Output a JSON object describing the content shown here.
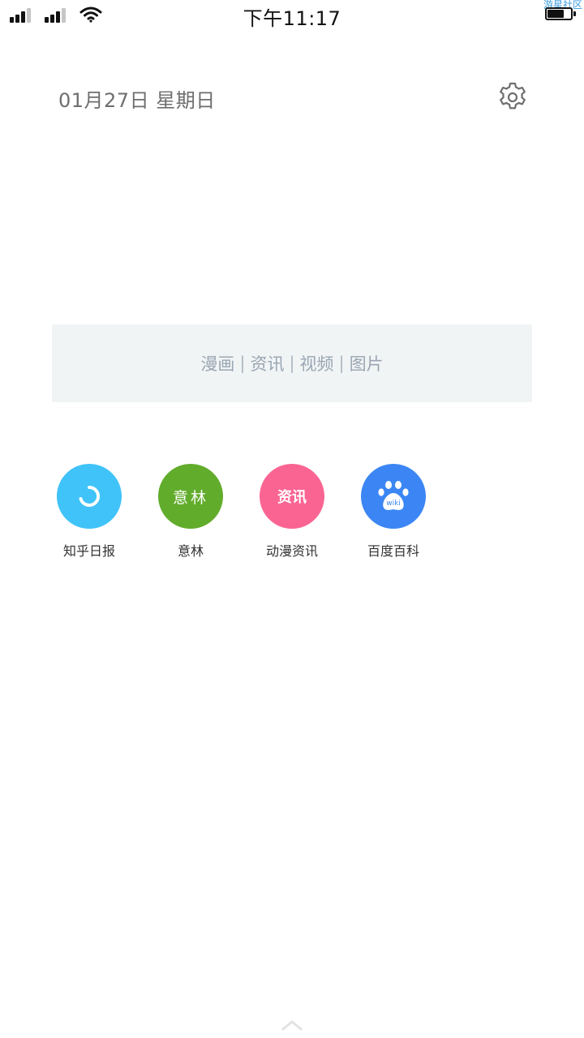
{
  "status_bar": {
    "time": "下午11:17",
    "watermark": "游星社区",
    "battery_level": 0.7,
    "icons": [
      "signal-icon",
      "signal-icon",
      "wifi-icon",
      "battery-icon"
    ]
  },
  "header": {
    "date": "01月27日 星期日",
    "settings_icon": "gear-icon"
  },
  "banner": {
    "links": [
      "漫画",
      "资讯",
      "视频",
      "图片"
    ],
    "separator": "|"
  },
  "shortcuts": [
    {
      "label": "知乎日报",
      "icon": "zhihu-daily-icon",
      "color": "#3fc3f9"
    },
    {
      "label": "意林",
      "icon_text": "意林",
      "color": "#62ac2c"
    },
    {
      "label": "动漫资讯",
      "icon_text": "资讯",
      "color": "#fa6493"
    },
    {
      "label": "百度百科",
      "icon": "baidu-paw-icon",
      "icon_text": "wiki",
      "color": "#3b86f4"
    }
  ],
  "footer": {
    "icon": "chevron-up-icon"
  }
}
